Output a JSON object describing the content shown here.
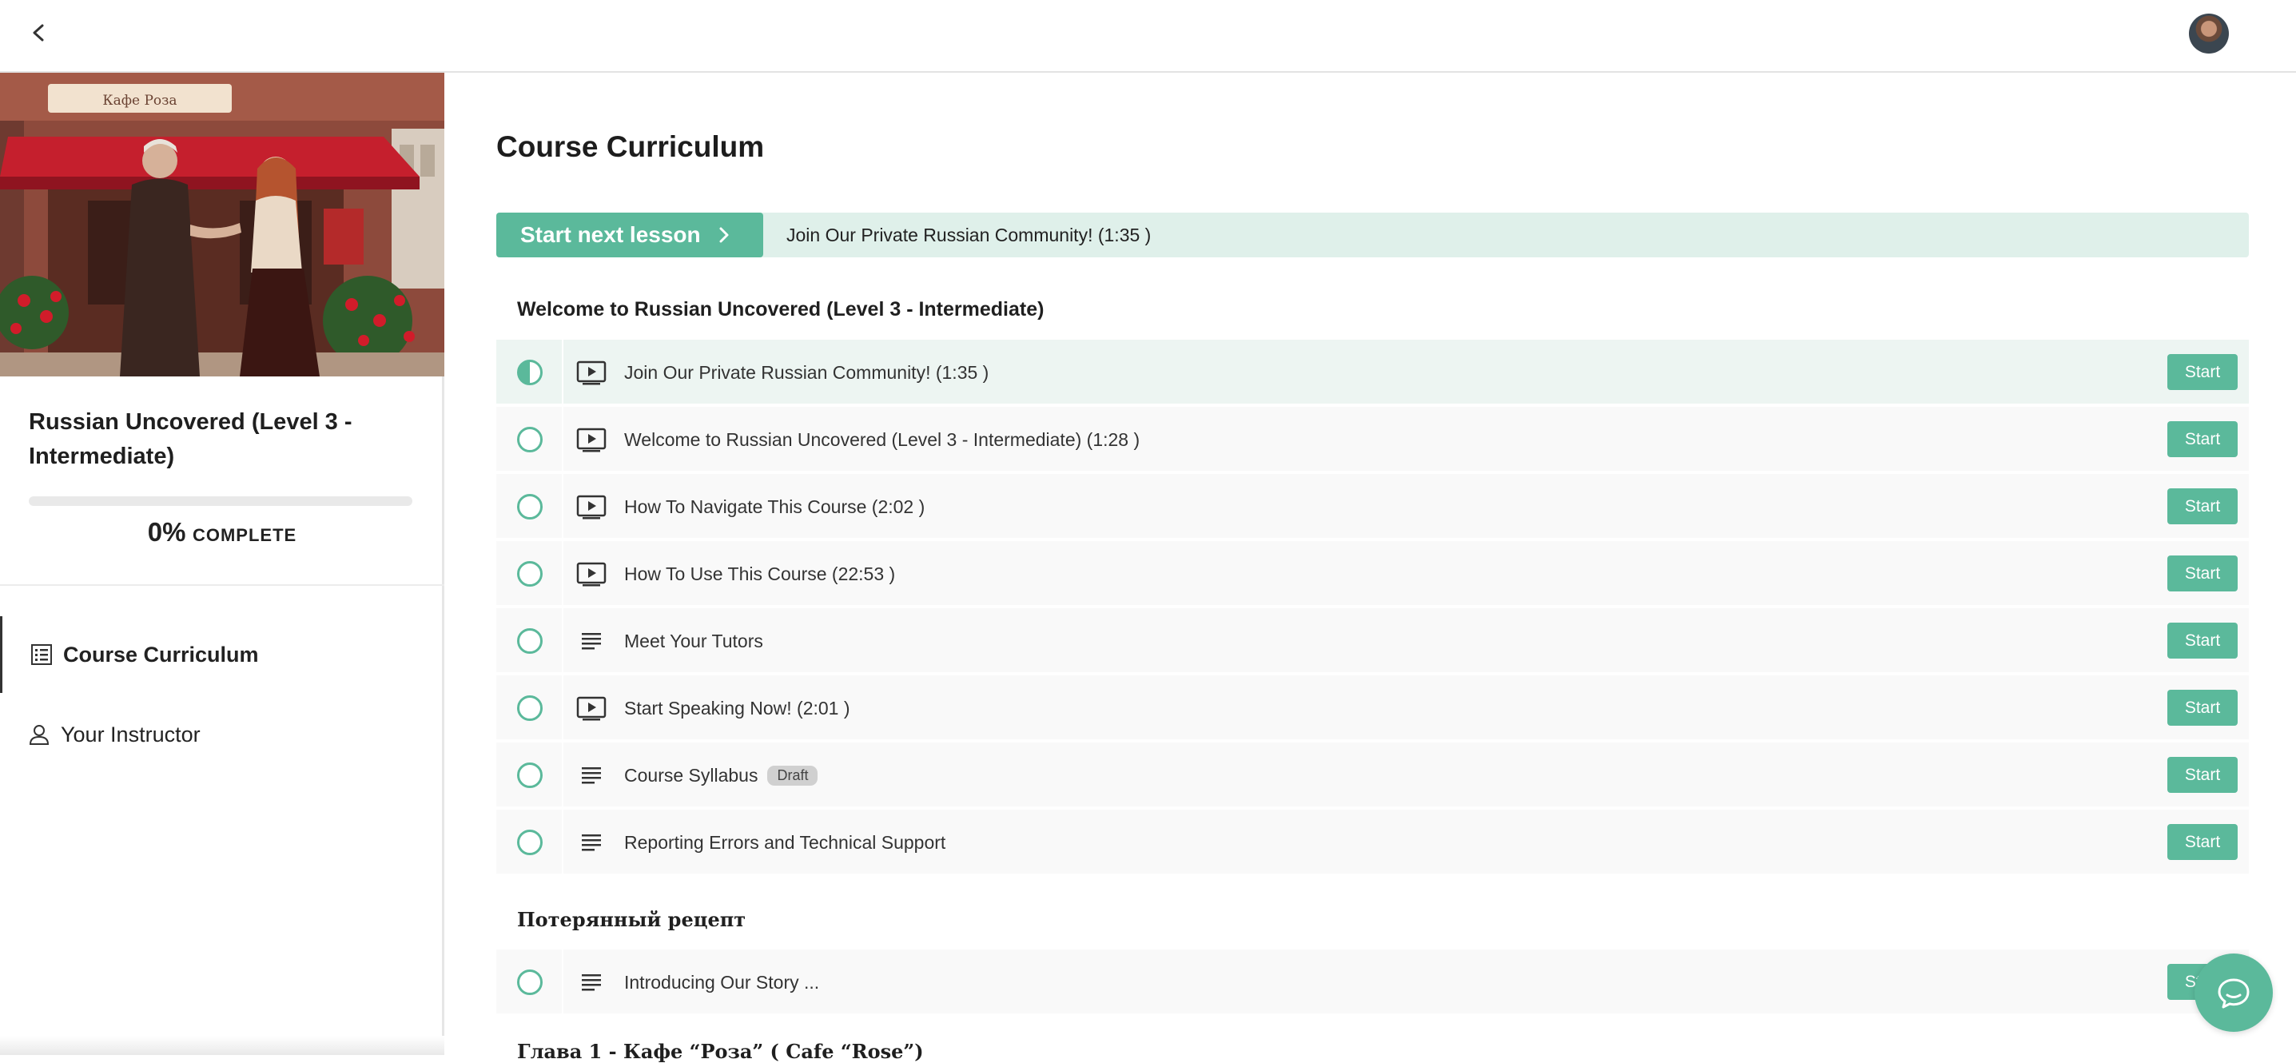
{
  "topbar": {
    "back_icon": "chevron-left-icon",
    "avatar_icon": "user-avatar"
  },
  "sidebar": {
    "course_title": "Russian Uncovered (Level 3 - Intermediate)",
    "hero_image": "cafe-scene-illustration",
    "hero_sign": "Кафе Роза",
    "progress_value": "0%",
    "progress_word": "COMPLETE",
    "progress_fraction": 0,
    "nav": [
      {
        "label": "Course Curriculum",
        "icon": "curriculum-list-icon",
        "active": true
      },
      {
        "label": "Your Instructor",
        "icon": "person-icon",
        "active": false
      }
    ]
  },
  "main": {
    "page_title": "Course Curriculum",
    "next_lesson": {
      "button_label": "Start next lesson",
      "lesson_title": "Join Our Private Russian Community! (1:35 )"
    },
    "sections": [
      {
        "title": "Welcome to Russian Uncovered (Level 3 - Intermediate)",
        "lectures": [
          {
            "title": "Join Our Private Russian Community! (1:35 )",
            "type": "video",
            "status": "in-progress",
            "action": "Start"
          },
          {
            "title": "Welcome to Russian Uncovered (Level 3 - Intermediate) (1:28 )",
            "type": "video",
            "status": "not-started",
            "action": "Start"
          },
          {
            "title": "How To Navigate This Course (2:02 )",
            "type": "video",
            "status": "not-started",
            "action": "Start"
          },
          {
            "title": "How To Use This Course (22:53 )",
            "type": "video",
            "status": "not-started",
            "action": "Start"
          },
          {
            "title": "Meet Your Tutors",
            "type": "text",
            "status": "not-started",
            "action": "Start"
          },
          {
            "title": "Start Speaking Now! (2:01 )",
            "type": "video",
            "status": "not-started",
            "action": "Start"
          },
          {
            "title": "Course Syllabus",
            "badge": "Draft",
            "type": "text",
            "status": "not-started",
            "action": "Start"
          },
          {
            "title": "Reporting Errors and Technical Support",
            "type": "text",
            "status": "not-started",
            "action": "Start"
          }
        ]
      },
      {
        "title": "Потерянный рецепт",
        "lectures": [
          {
            "title": "Introducing Our Story ...",
            "type": "text",
            "status": "not-started",
            "action": "Start"
          }
        ]
      },
      {
        "title": "Глава 1 - Кафе “Роза” ( Cafe “Rose”)",
        "lectures": []
      }
    ]
  },
  "chat": {
    "icon": "chat-bubble-icon"
  },
  "colors": {
    "accent": "#5bb99b",
    "accent_light": "#dff0ea",
    "row_bg": "#f9f9f9",
    "row_current_bg": "#edf5f2"
  }
}
